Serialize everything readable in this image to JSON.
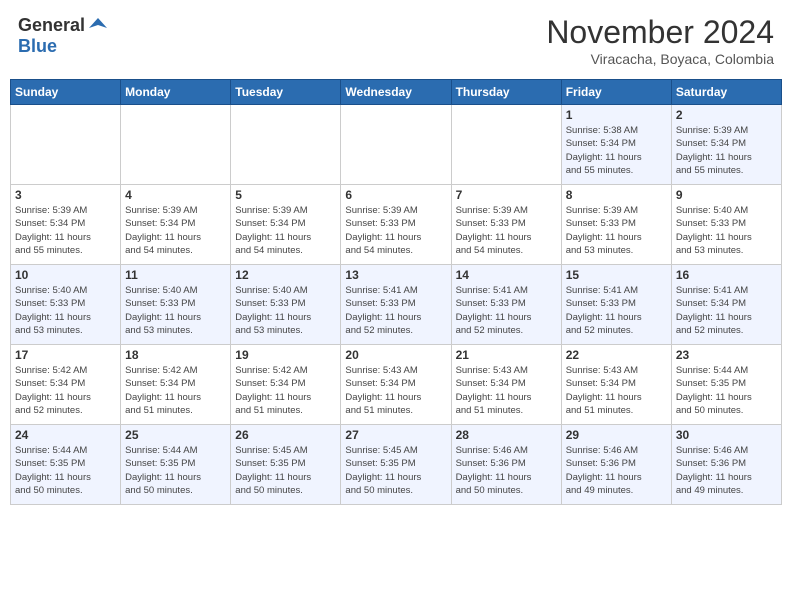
{
  "header": {
    "logo_general": "General",
    "logo_blue": "Blue",
    "month_title": "November 2024",
    "location": "Viracacha, Boyaca, Colombia"
  },
  "days_of_week": [
    "Sunday",
    "Monday",
    "Tuesday",
    "Wednesday",
    "Thursday",
    "Friday",
    "Saturday"
  ],
  "weeks": [
    [
      {
        "day": "",
        "info": ""
      },
      {
        "day": "",
        "info": ""
      },
      {
        "day": "",
        "info": ""
      },
      {
        "day": "",
        "info": ""
      },
      {
        "day": "",
        "info": ""
      },
      {
        "day": "1",
        "info": "Sunrise: 5:38 AM\nSunset: 5:34 PM\nDaylight: 11 hours\nand 55 minutes."
      },
      {
        "day": "2",
        "info": "Sunrise: 5:39 AM\nSunset: 5:34 PM\nDaylight: 11 hours\nand 55 minutes."
      }
    ],
    [
      {
        "day": "3",
        "info": "Sunrise: 5:39 AM\nSunset: 5:34 PM\nDaylight: 11 hours\nand 55 minutes."
      },
      {
        "day": "4",
        "info": "Sunrise: 5:39 AM\nSunset: 5:34 PM\nDaylight: 11 hours\nand 54 minutes."
      },
      {
        "day": "5",
        "info": "Sunrise: 5:39 AM\nSunset: 5:34 PM\nDaylight: 11 hours\nand 54 minutes."
      },
      {
        "day": "6",
        "info": "Sunrise: 5:39 AM\nSunset: 5:33 PM\nDaylight: 11 hours\nand 54 minutes."
      },
      {
        "day": "7",
        "info": "Sunrise: 5:39 AM\nSunset: 5:33 PM\nDaylight: 11 hours\nand 54 minutes."
      },
      {
        "day": "8",
        "info": "Sunrise: 5:39 AM\nSunset: 5:33 PM\nDaylight: 11 hours\nand 53 minutes."
      },
      {
        "day": "9",
        "info": "Sunrise: 5:40 AM\nSunset: 5:33 PM\nDaylight: 11 hours\nand 53 minutes."
      }
    ],
    [
      {
        "day": "10",
        "info": "Sunrise: 5:40 AM\nSunset: 5:33 PM\nDaylight: 11 hours\nand 53 minutes."
      },
      {
        "day": "11",
        "info": "Sunrise: 5:40 AM\nSunset: 5:33 PM\nDaylight: 11 hours\nand 53 minutes."
      },
      {
        "day": "12",
        "info": "Sunrise: 5:40 AM\nSunset: 5:33 PM\nDaylight: 11 hours\nand 53 minutes."
      },
      {
        "day": "13",
        "info": "Sunrise: 5:41 AM\nSunset: 5:33 PM\nDaylight: 11 hours\nand 52 minutes."
      },
      {
        "day": "14",
        "info": "Sunrise: 5:41 AM\nSunset: 5:33 PM\nDaylight: 11 hours\nand 52 minutes."
      },
      {
        "day": "15",
        "info": "Sunrise: 5:41 AM\nSunset: 5:33 PM\nDaylight: 11 hours\nand 52 minutes."
      },
      {
        "day": "16",
        "info": "Sunrise: 5:41 AM\nSunset: 5:34 PM\nDaylight: 11 hours\nand 52 minutes."
      }
    ],
    [
      {
        "day": "17",
        "info": "Sunrise: 5:42 AM\nSunset: 5:34 PM\nDaylight: 11 hours\nand 52 minutes."
      },
      {
        "day": "18",
        "info": "Sunrise: 5:42 AM\nSunset: 5:34 PM\nDaylight: 11 hours\nand 51 minutes."
      },
      {
        "day": "19",
        "info": "Sunrise: 5:42 AM\nSunset: 5:34 PM\nDaylight: 11 hours\nand 51 minutes."
      },
      {
        "day": "20",
        "info": "Sunrise: 5:43 AM\nSunset: 5:34 PM\nDaylight: 11 hours\nand 51 minutes."
      },
      {
        "day": "21",
        "info": "Sunrise: 5:43 AM\nSunset: 5:34 PM\nDaylight: 11 hours\nand 51 minutes."
      },
      {
        "day": "22",
        "info": "Sunrise: 5:43 AM\nSunset: 5:34 PM\nDaylight: 11 hours\nand 51 minutes."
      },
      {
        "day": "23",
        "info": "Sunrise: 5:44 AM\nSunset: 5:35 PM\nDaylight: 11 hours\nand 50 minutes."
      }
    ],
    [
      {
        "day": "24",
        "info": "Sunrise: 5:44 AM\nSunset: 5:35 PM\nDaylight: 11 hours\nand 50 minutes."
      },
      {
        "day": "25",
        "info": "Sunrise: 5:44 AM\nSunset: 5:35 PM\nDaylight: 11 hours\nand 50 minutes."
      },
      {
        "day": "26",
        "info": "Sunrise: 5:45 AM\nSunset: 5:35 PM\nDaylight: 11 hours\nand 50 minutes."
      },
      {
        "day": "27",
        "info": "Sunrise: 5:45 AM\nSunset: 5:35 PM\nDaylight: 11 hours\nand 50 minutes."
      },
      {
        "day": "28",
        "info": "Sunrise: 5:46 AM\nSunset: 5:36 PM\nDaylight: 11 hours\nand 50 minutes."
      },
      {
        "day": "29",
        "info": "Sunrise: 5:46 AM\nSunset: 5:36 PM\nDaylight: 11 hours\nand 49 minutes."
      },
      {
        "day": "30",
        "info": "Sunrise: 5:46 AM\nSunset: 5:36 PM\nDaylight: 11 hours\nand 49 minutes."
      }
    ]
  ]
}
